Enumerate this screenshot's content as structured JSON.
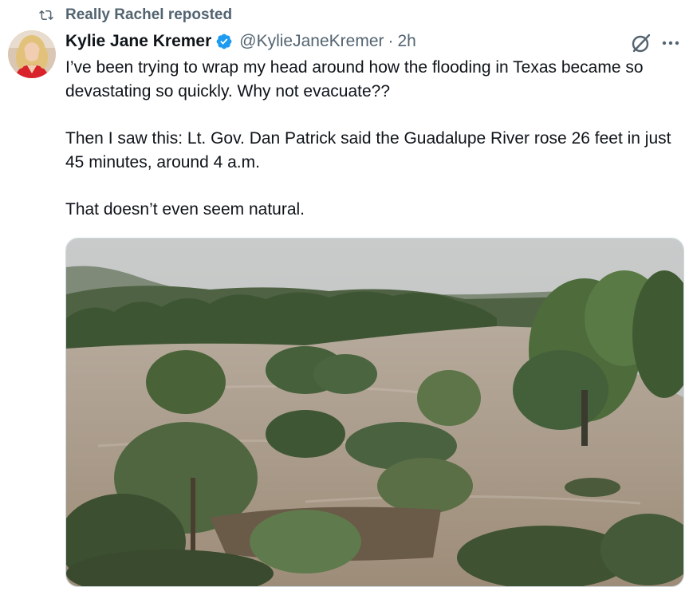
{
  "repost": {
    "icon": "repost-icon",
    "text": "Really Rachel reposted"
  },
  "author": {
    "display_name": "Kylie Jane Kremer",
    "handle": "@KylieJaneKremer",
    "separator": "·",
    "time": "2h",
    "verified_icon": "verified-badge-icon",
    "avatar_icon": "avatar"
  },
  "actions": {
    "grok_icon": "grok-icon",
    "more_icon": "more-options-icon"
  },
  "tweet": {
    "paragraphs": [
      "I’ve been trying to wrap my head around how the flooding in Texas became so devastating so quickly. Why not evacuate??",
      "Then I saw this: Lt. Gov. Dan Patrick said the Guadalupe River rose 26 feet in just 45 minutes, around 4 a.m.",
      "That doesn’t even seem natural."
    ]
  },
  "media": {
    "kind": "photo",
    "icon": "flooded-river-photo"
  },
  "colors": {
    "text": "#0f1419",
    "secondary": "#536471",
    "verified": "#1d9bf0",
    "border": "#cfd9de"
  }
}
